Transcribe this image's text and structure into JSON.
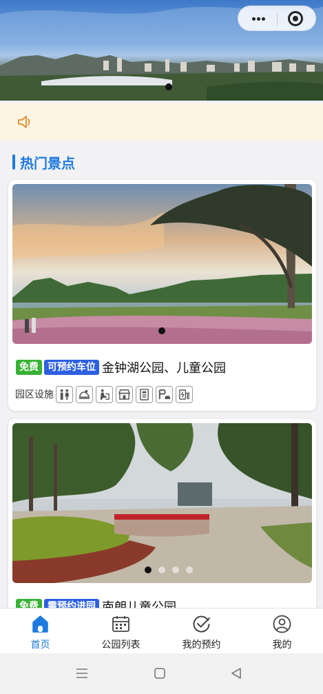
{
  "banner": {
    "slide_count": 1,
    "active_slide": 1
  },
  "capsule": {
    "more_icon": "more-icon",
    "close_icon": "mini-program-close-icon"
  },
  "notice": {
    "icon": "speaker-icon",
    "text": ""
  },
  "section": {
    "title": "热门景点"
  },
  "parks": [
    {
      "tags": [
        {
          "label": "免费",
          "color": "#38b235"
        },
        {
          "label": "可预约车位",
          "color": "#2d5fe0"
        }
      ],
      "name": "金钟湖公园、儿童公园",
      "facility_label": "园区设施",
      "facilities": [
        "toilet-icon",
        "playground-icon",
        "nursery-icon",
        "shop-icon",
        "info-board-icon",
        "parking-icon",
        "charging-icon"
      ],
      "slide_count": 1,
      "active_slide": 1
    },
    {
      "tags": [
        {
          "label": "免费",
          "color": "#38b235"
        },
        {
          "label": "需预约进园",
          "color": "#2d5fe0"
        }
      ],
      "name": "南朗儿童公园",
      "slide_count": 4,
      "active_slide": 1
    }
  ],
  "tabbar": [
    {
      "label": "首页",
      "icon": "home-icon",
      "active": true
    },
    {
      "label": "公园列表",
      "icon": "park-list-icon",
      "active": false
    },
    {
      "label": "我的预约",
      "icon": "my-booking-icon",
      "active": false
    },
    {
      "label": "我的",
      "icon": "profile-icon",
      "active": false
    }
  ],
  "colors": {
    "accent": "#1f7ae0",
    "free_tag": "#38b235",
    "booking_tag": "#2d5fe0",
    "notice_bg": "#fdf5e2"
  }
}
